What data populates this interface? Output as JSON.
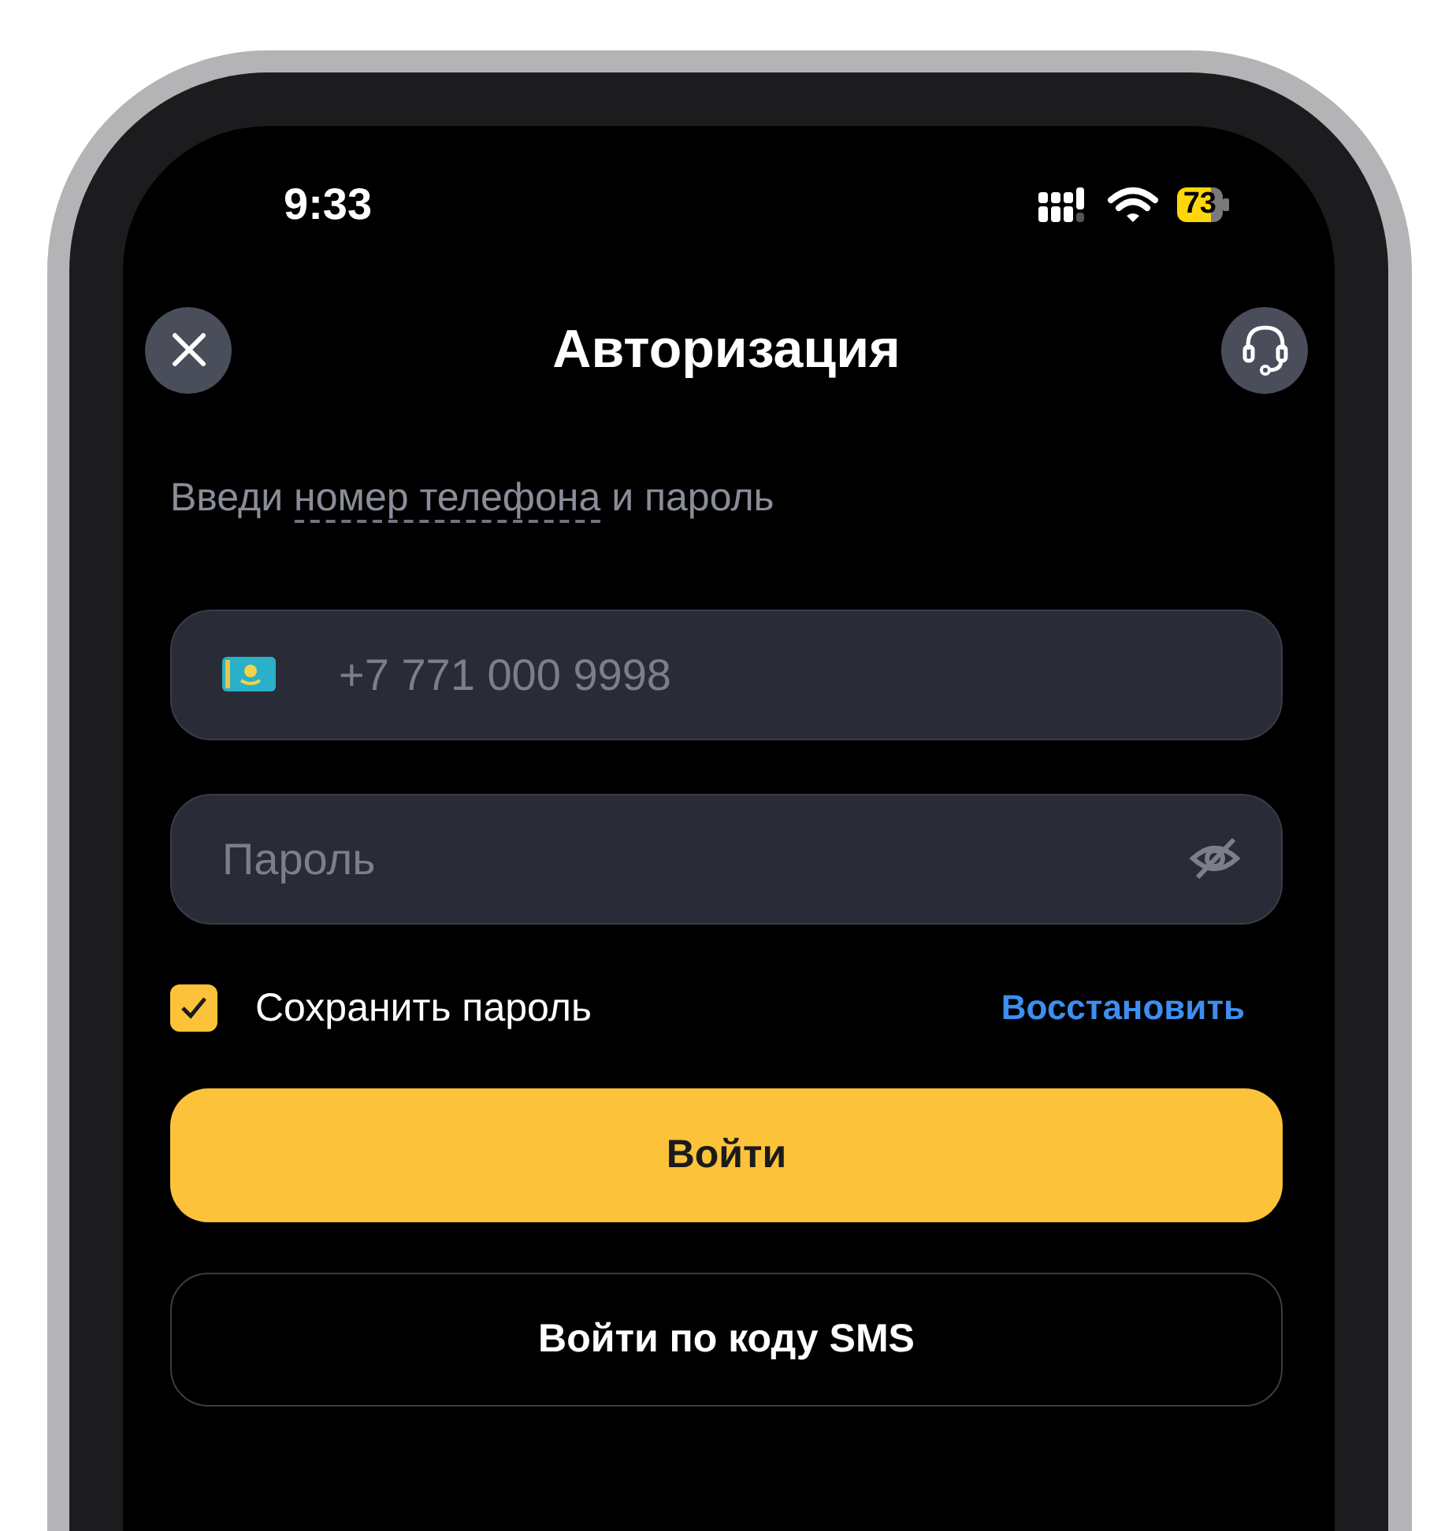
{
  "status_bar": {
    "time": "9:33",
    "battery": "73"
  },
  "header": {
    "title": "Авторизация"
  },
  "subtitle": {
    "before": "Введи",
    "link": "номер телефона",
    "after": "и пароль"
  },
  "fields": [
    {
      "kind": "phone",
      "placeholder": "+7 771 000 9998"
    },
    {
      "kind": "password",
      "placeholder": "Пароль"
    }
  ],
  "remember": {
    "label": "Сохранить пароль",
    "checked": true
  },
  "restore_link": "Восстановить",
  "buttons": [
    {
      "kind": "primary",
      "label": "Войти"
    },
    {
      "kind": "secondary",
      "label": "Войти по коду SMS"
    }
  ]
}
